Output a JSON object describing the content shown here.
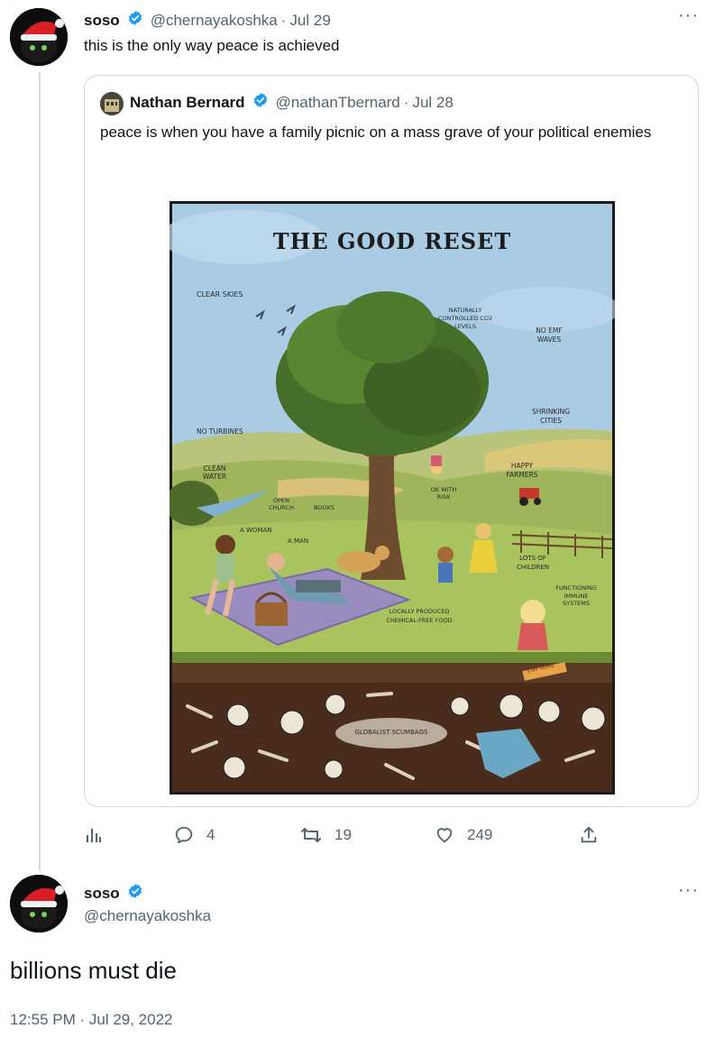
{
  "tweet": {
    "display_name": "soso",
    "handle": "@chernayakoshka",
    "date": "Jul 29",
    "text": "this is the only way peace is achieved",
    "more_icon": "more-horizontal-icon"
  },
  "quoted_tweet": {
    "display_name": "Nathan Bernard",
    "handle": "@nathanTbernard",
    "date": "Jul 28",
    "text": "peace is when you have a family picnic on a mass grave of your political enemies",
    "image": {
      "title": "THE GOOD RESET",
      "labels": {
        "clear_skies": "CLEAR SKIES",
        "co2_1": "NATURALLY",
        "co2_2": "CONTROLLED CO2",
        "co2_3": "LEVELS",
        "emf_1": "NO EMF",
        "emf_2": "WAVES",
        "shrinking_1": "SHRINKING",
        "shrinking_2": "CITIES",
        "turbines": "NO TURBINES",
        "water_1": "CLEAN",
        "water_2": "WATER",
        "farmers_1": "HAPPY",
        "farmers_2": "FARMERS",
        "church_1": "OPEN",
        "church_2": "CHURCH",
        "books": "BOOKS",
        "risk_1": "OK WITH",
        "risk_2": "RISK",
        "woman": "A WOMAN",
        "man": "A MAN",
        "children_1": "LOTS OF",
        "children_2": "CHILDREN",
        "immune_1": "FUNCTIONING",
        "immune_2": "IMMUNE",
        "immune_3": "SYSTEMS",
        "food_1": "LOCALLY PRODUCED",
        "food_2": "CHEMICAL-FREE FOOD",
        "stay_home": "STAY HOME",
        "scumbags": "GLOBALIST SCUMBAGS"
      }
    }
  },
  "actions": {
    "analytics_icon": "analytics-icon",
    "reply_icon": "reply-icon",
    "reply_count": "4",
    "retweet_icon": "retweet-icon",
    "retweet_count": "19",
    "like_icon": "heart-icon",
    "like_count": "249",
    "share_icon": "share-icon"
  },
  "reply": {
    "display_name": "soso",
    "handle": "@chernayakoshka",
    "text": "billions must die",
    "timestamp": "12:55 PM · Jul 29, 2022"
  },
  "colors": {
    "verified_blue": "#1d9bf0",
    "text": "#0f1419",
    "muted": "#536471",
    "border": "#cfd9de"
  }
}
